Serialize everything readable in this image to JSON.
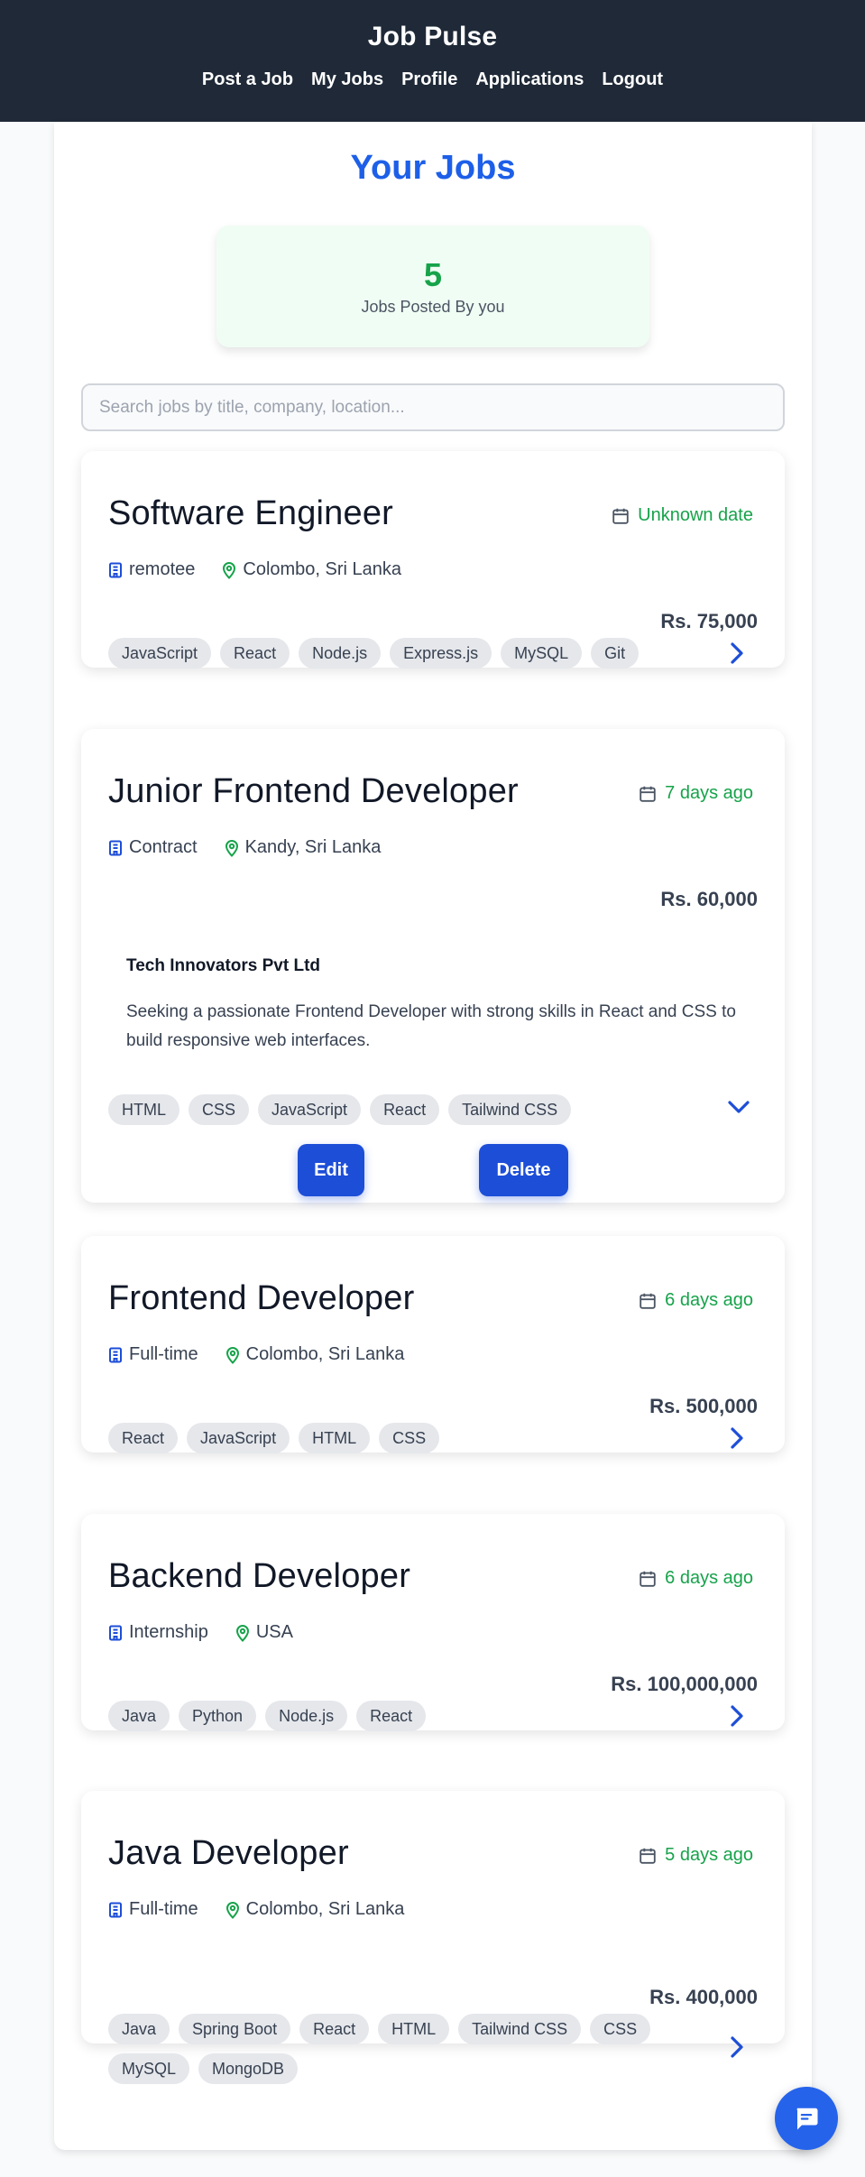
{
  "header": {
    "brand": "Job Pulse",
    "nav": [
      "Post a Job",
      "My Jobs",
      "Profile",
      "Applications",
      "Logout"
    ]
  },
  "page": {
    "title": "Your Jobs",
    "stat_count": "5",
    "stat_label": "Jobs Posted By you",
    "search_placeholder": "Search jobs by title, company, location..."
  },
  "jobs": [
    {
      "title": "Software Engineer",
      "date": "Unknown date",
      "type": "remotee",
      "location": "Colombo, Sri Lanka",
      "salary": "Rs. 75,000",
      "tags": [
        "JavaScript",
        "React",
        "Node.js",
        "Express.js",
        "MySQL",
        "Git"
      ],
      "expanded": false
    },
    {
      "title": "Junior Frontend Developer",
      "date": "7 days ago",
      "type": "Contract",
      "location": "Kandy, Sri Lanka",
      "salary": "Rs. 60,000",
      "company": "Tech Innovators Pvt Ltd",
      "description": "Seeking a passionate Frontend Developer with strong skills in React and CSS to build responsive web interfaces.",
      "tags": [
        "HTML",
        "CSS",
        "JavaScript",
        "React",
        "Tailwind CSS"
      ],
      "expanded": true,
      "edit_label": "Edit",
      "delete_label": "Delete"
    },
    {
      "title": "Frontend Developer",
      "date": "6 days ago",
      "type": "Full-time",
      "location": "Colombo, Sri Lanka",
      "salary": "Rs. 500,000",
      "tags": [
        "React",
        "JavaScript",
        "HTML",
        "CSS"
      ],
      "expanded": false
    },
    {
      "title": "Backend Developer",
      "date": "6 days ago",
      "type": "Internship",
      "location": "USA",
      "salary": "Rs. 100,000,000",
      "tags": [
        "Java",
        "Python",
        "Node.js",
        "React"
      ],
      "expanded": false
    },
    {
      "title": "Java Developer",
      "date": "5 days ago",
      "type": "Full-time",
      "location": "Colombo, Sri Lanka",
      "salary": "Rs. 400,000",
      "tags": [
        "Java",
        "Spring Boot",
        "React",
        "HTML",
        "Tailwind CSS",
        "CSS",
        "MySQL",
        "MongoDB"
      ],
      "expanded": false
    }
  ],
  "colors": {
    "header_bg": "#1f2937",
    "accent_blue": "#1d5fe8",
    "date_green": "#16a34a",
    "stat_bg": "#f0fdf4"
  },
  "icons": {
    "date": "calendar-icon",
    "type": "building-icon",
    "location": "map-pin-icon",
    "collapsed": "chevron-right-icon",
    "expanded": "chevron-down-icon",
    "chat": "chat-icon"
  }
}
